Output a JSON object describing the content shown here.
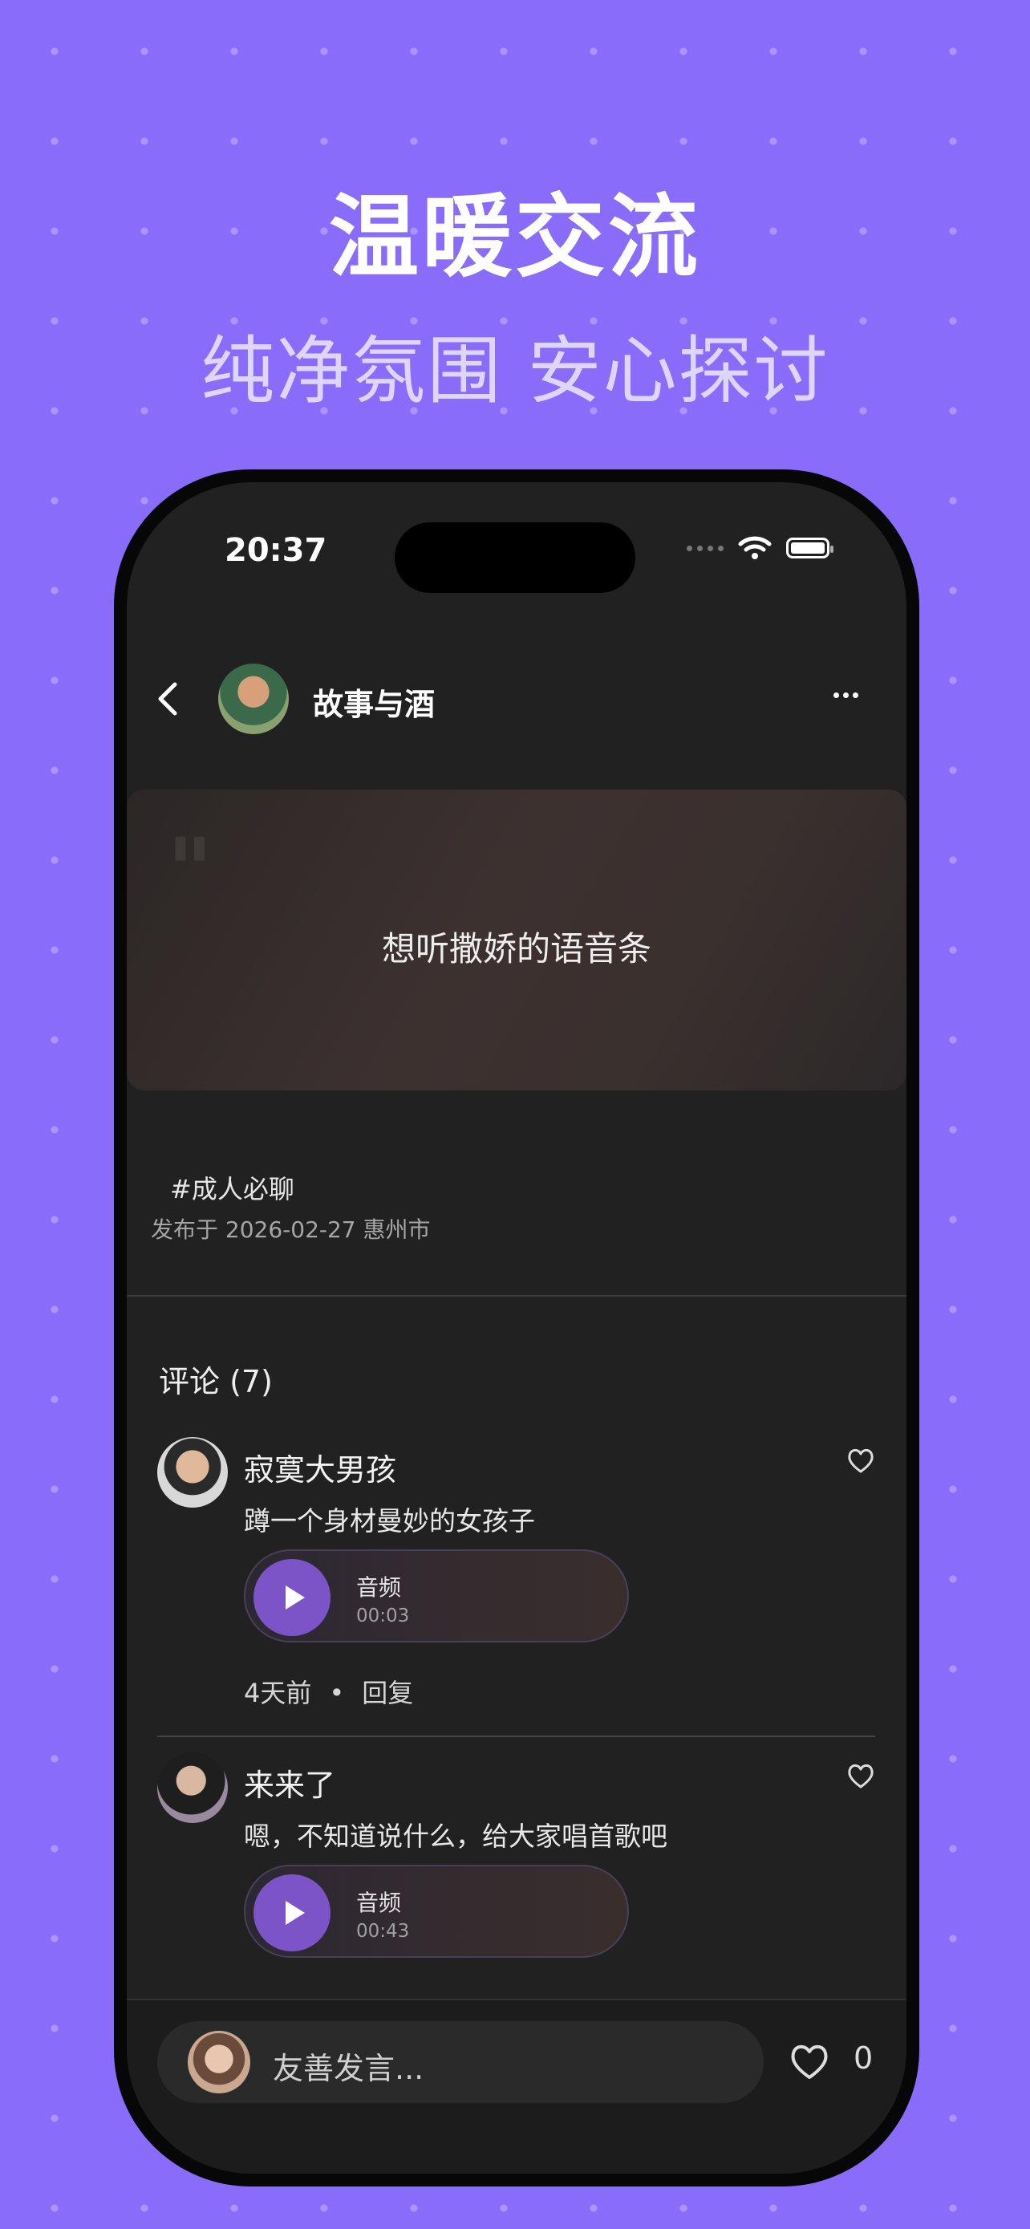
{
  "promo": {
    "headline": "温暖交流",
    "subline": "纯净氛围 安心探讨"
  },
  "status_bar": {
    "time": "20:37"
  },
  "header": {
    "author_name": "故事与酒"
  },
  "post": {
    "quote_mark": "\"",
    "text": "想听撒娇的语音条",
    "tag": "#成人必聊",
    "meta": "发布于 2026-02-27 惠州市"
  },
  "comments_section": {
    "title": "评论 (7)",
    "items": [
      {
        "name": "寂寞大男孩",
        "text": "蹲一个身材曼妙的女孩子",
        "audio_label": "音频",
        "audio_duration": "00:03",
        "time_ago": "4天前",
        "dot": "•",
        "reply": "回复"
      },
      {
        "name": "来来了",
        "text": "嗯，不知道说什么，给大家唱首歌吧",
        "audio_label": "音频",
        "audio_duration": "00:43",
        "time_ago": "",
        "dot": "",
        "reply": ""
      }
    ]
  },
  "bottom_bar": {
    "input_placeholder": "友善发言...",
    "like_count": "0"
  },
  "colors": {
    "background": "#8a6cfb",
    "screen": "#212121",
    "accent_play": "#7c54c8"
  },
  "icons": [
    "back-chevron-icon",
    "more-dots-icon",
    "heart-outline-icon",
    "play-icon",
    "wifi-icon",
    "battery-icon"
  ]
}
